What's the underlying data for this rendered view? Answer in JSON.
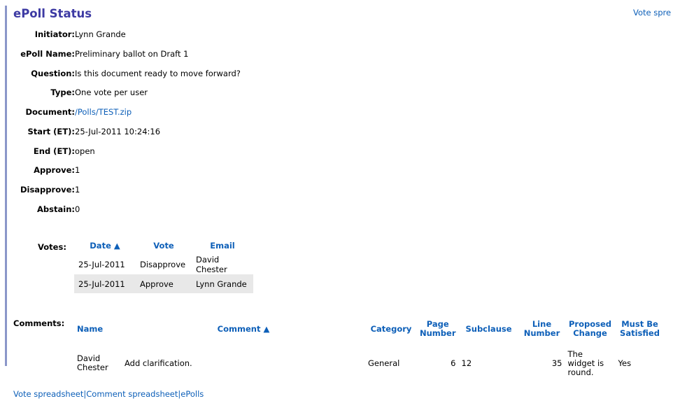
{
  "header": {
    "title": "ePoll Status",
    "top_link": "Vote spre"
  },
  "fields": [
    {
      "label": "Initiator:",
      "value": "Lynn Grande"
    },
    {
      "label": "ePoll Name:",
      "value": "Preliminary ballot on Draft 1"
    },
    {
      "label": "Question:",
      "value": "Is this document ready to move forward?"
    },
    {
      "label": "Type:",
      "value": "One vote per user"
    },
    {
      "label": "Document:",
      "value": "/Polls/TEST.zip"
    },
    {
      "label": "Start (ET):",
      "value": "25-Jul-2011 10:24:16"
    },
    {
      "label": "End (ET):",
      "value": "open"
    },
    {
      "label": "Approve:",
      "value": "1"
    },
    {
      "label": "Disapprove:",
      "value": "1"
    },
    {
      "label": "Abstain:",
      "value": "0"
    }
  ],
  "votes": {
    "label": "Votes:",
    "headers": [
      "Date ▲",
      "Vote",
      "Email"
    ],
    "rows": [
      [
        "25-Jul-2011",
        "Disapprove",
        "David Chester"
      ],
      [
        "25-Jul-2011",
        "Approve",
        "Lynn Grande"
      ]
    ]
  },
  "comments": {
    "label": "Comments:",
    "headers": {
      "name": "Name",
      "comment": "Comment ▲",
      "category": "Category",
      "page_line1": "Page",
      "page_line2": "Number",
      "subclause": "Subclause",
      "line_line1": "Line",
      "line_line2": "Number",
      "proposed_line1": "Proposed",
      "proposed_line2": "Change",
      "must_line1": "Must Be",
      "must_line2": "Satisfied"
    },
    "rows": [
      {
        "name_line1": "David",
        "name_line2": "Chester",
        "comment": "Add clarification.",
        "category": "General",
        "page": "6",
        "subclause": "12",
        "line": "35",
        "proposed_line1": "The",
        "proposed_line2": "widget is",
        "proposed_line3": "round.",
        "must": "Yes"
      }
    ]
  },
  "footer": {
    "links": [
      "Vote spreadsheet",
      "Comment spreadsheet",
      "ePolls"
    ],
    "separator": "|"
  },
  "colors": {
    "title": "#3d3aa3",
    "link": "#0d5fb8",
    "left_bar": "#8b97c9",
    "row_shade": "#e8e8e8"
  }
}
